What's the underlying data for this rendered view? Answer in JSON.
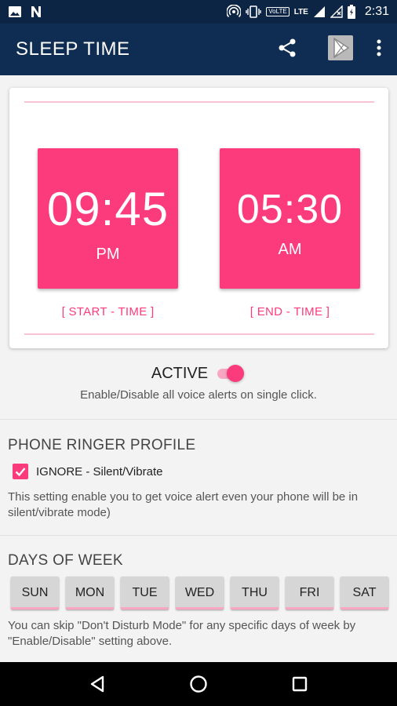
{
  "status_bar": {
    "icons": [
      "image-icon",
      "n-notification-icon",
      "hotspot-icon",
      "vibrate-icon",
      "volte-icon",
      "lte-signal-icon",
      "signal-icon",
      "no-sim-icon",
      "battery-icon"
    ],
    "volte": "VoLTE",
    "lte": "LTE",
    "time": "2:31"
  },
  "app_bar": {
    "title": "SLEEP TIME",
    "actions": [
      "share-icon",
      "play-store-icon",
      "more-vert-icon"
    ]
  },
  "schedule": {
    "start": {
      "time": "09:45",
      "period": "PM",
      "label": "[ START - TIME ]"
    },
    "end": {
      "time": "05:30",
      "period": "AM",
      "label": "[ END - TIME ]"
    }
  },
  "active": {
    "label": "ACTIVE",
    "enabled": true,
    "description": "Enable/Disable all voice alerts on single click."
  },
  "ringer": {
    "title": "PHONE RINGER PROFILE",
    "checkbox_label": "IGNORE - Silent/Vibrate",
    "checked": true,
    "description": "This setting enable you to get voice alert even your phone will be in silent/vibrate mode)"
  },
  "days": {
    "title": "DAYS OF WEEK",
    "items": [
      "SUN",
      "MON",
      "TUE",
      "WED",
      "THU",
      "FRI",
      "SAT"
    ],
    "description": "You can skip \"Don't Disturb Mode\" for any specific days of week by \"Enable/Disable\" setting above."
  },
  "colors": {
    "accent": "#fb3b7b",
    "app_bar": "#0f2d52",
    "status_bar": "#0d2545"
  },
  "nav": [
    "back-icon",
    "home-icon",
    "recents-icon"
  ]
}
